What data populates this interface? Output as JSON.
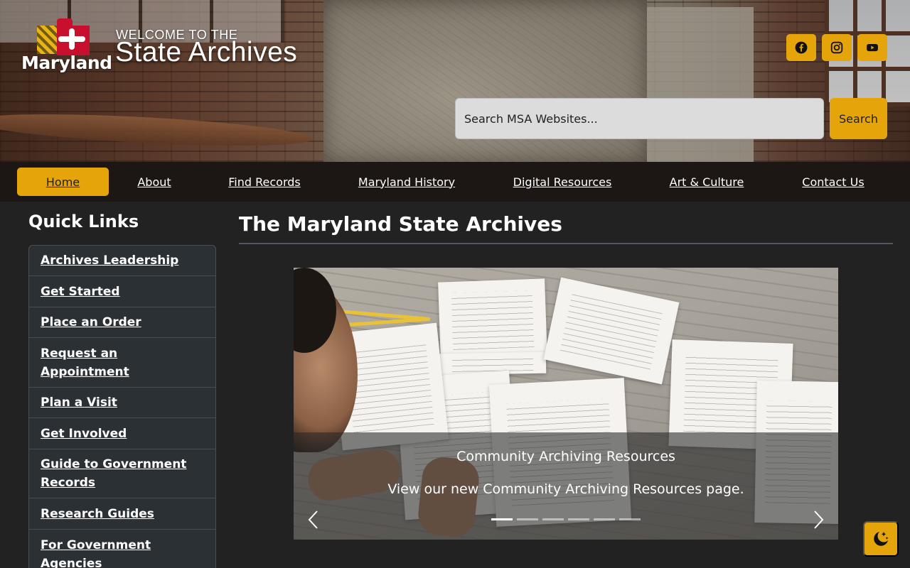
{
  "header": {
    "logo_word": "Maryland",
    "welcome_line": "WELCOME TO THE",
    "site_title": "State Archives",
    "social": [
      {
        "name": "facebook-icon"
      },
      {
        "name": "instagram-icon"
      },
      {
        "name": "youtube-icon"
      }
    ],
    "search": {
      "placeholder": "Search MSA Websites...",
      "button_label": "Search"
    }
  },
  "nav": {
    "items": [
      {
        "label": "Home",
        "active": true
      },
      {
        "label": "About"
      },
      {
        "label": "Find Records"
      },
      {
        "label": "Maryland History"
      },
      {
        "label": "Digital Resources"
      },
      {
        "label": "Art & Culture"
      },
      {
        "label": "Contact Us"
      }
    ]
  },
  "sidebar": {
    "title": "Quick Links",
    "items": [
      {
        "label": "Archives Leadership"
      },
      {
        "label": "Get Started"
      },
      {
        "label": "Place an Order"
      },
      {
        "label": "Request an Appointment"
      },
      {
        "label": "Plan a Visit"
      },
      {
        "label": "Get Involved"
      },
      {
        "label": "Guide to Government Records"
      },
      {
        "label": "Research Guides"
      },
      {
        "label": "For Government Agencies"
      }
    ]
  },
  "main": {
    "page_title": "The Maryland State Archives",
    "carousel": {
      "slide_title": "Community Archiving Resources",
      "slide_text": "View our new Community Archiving Resources page.",
      "slide_count": 6,
      "active_index": 0,
      "prev_icon": "chevron-left-icon",
      "next_icon": "chevron-right-icon"
    }
  },
  "theme_toggle": {
    "icon": "moon-stars-icon"
  },
  "colors": {
    "accent": "#e5a50a",
    "background": "#222222",
    "sidebar_item": "#2b3035",
    "text": "#ffffff"
  }
}
